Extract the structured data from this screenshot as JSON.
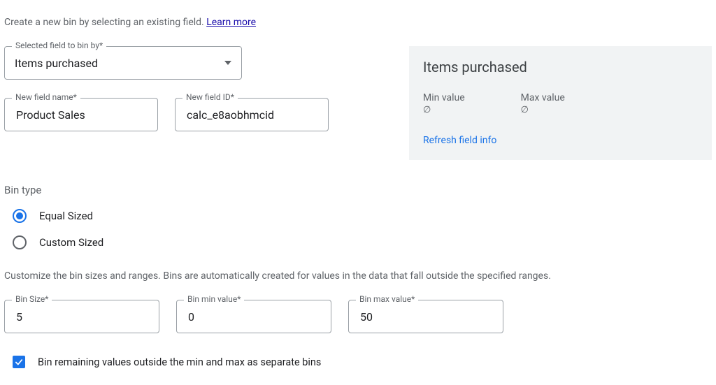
{
  "intro": {
    "text_before": "Create a new bin by selecting an existing field. ",
    "learn_more": "Learn more"
  },
  "fields": {
    "selected_field": {
      "label": "Selected field to bin by*",
      "value": "Items purchased"
    },
    "new_field_name": {
      "label": "New field name*",
      "value": "Product Sales"
    },
    "new_field_id": {
      "label": "New field ID*",
      "value": "calc_e8aobhmcid"
    }
  },
  "bin_type": {
    "heading": "Bin type",
    "options": {
      "equal": "Equal Sized",
      "custom": "Custom Sized"
    },
    "selected": "equal"
  },
  "customize_help": "Customize the bin sizes and ranges. Bins are automatically created for values in the data that fall outside the specified ranges.",
  "bin": {
    "size": {
      "label": "Bin Size*",
      "value": "5"
    },
    "min": {
      "label": "Bin min value*",
      "value": "0"
    },
    "max": {
      "label": "Bin max value*",
      "value": "50"
    }
  },
  "remaining_checkbox": {
    "label": "Bin remaining values outside the min and max as separate bins",
    "checked": true
  },
  "info_panel": {
    "title": "Items purchased",
    "min_label": "Min value",
    "min_value": "∅",
    "max_label": "Max value",
    "max_value": "∅",
    "refresh": "Refresh field info"
  }
}
